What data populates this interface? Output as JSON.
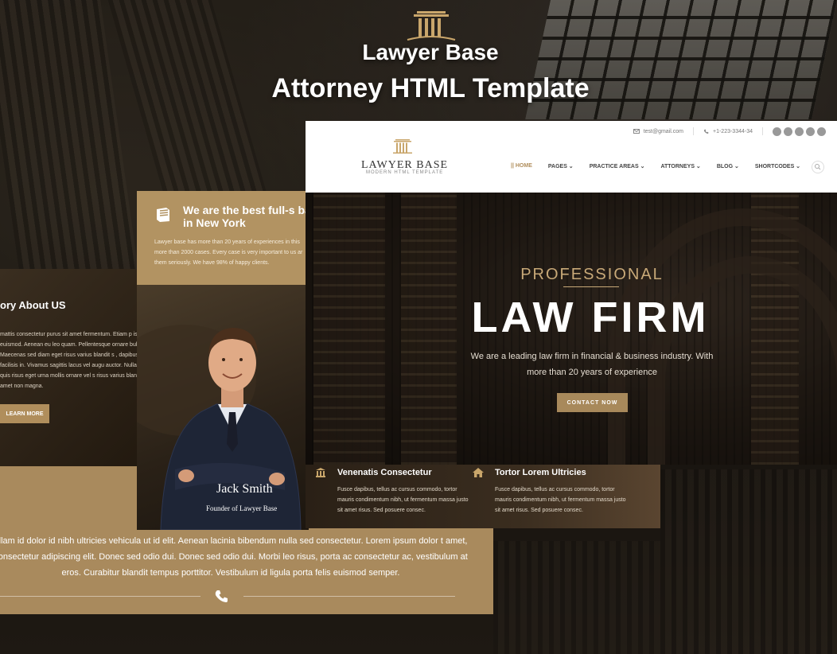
{
  "hero": {
    "line1": "Lawyer Base",
    "line2": "Attorney HTML Template"
  },
  "story": {
    "heading": "ory About US",
    "body": "mattis consectetur purus sit amet fermentum. Etiam p is euismod. Aenean eu leo quam. Pellentesque ornare bulum. Maecenas sed diam eget risus varius blandit s , dapibus ac facilisis in. Vivamus sagittis lacus vel augu auctor. Nullam quis risus eget urna mollis ornare vel s risus varius blandit sit amet non magna.",
    "button": "LEARN MORE"
  },
  "best": {
    "heading": "We are the best full-s based in New York",
    "body": "Lawyer base has more than 20 years of experiences in this more than 2000 cases. Every case is very important to us ar them seriously. We have 98% of happy clients."
  },
  "portrait": {
    "name": "Jack Smith",
    "role": "Founder of Lawyer Base"
  },
  "lower": {
    "text": "ullam id dolor id nibh ultricies vehicula ut id elit. Aenean lacinia bibendum nulla sed consectetur. Lorem ipsum dolor t amet, consectetur adipiscing elit. Donec sed odio dui. Donec sed odio dui. Morbi leo risus, porta ac consectetur ac, vestibulum at eros. Curabitur blandit tempus porttitor. Vestibulum id ligula porta felis euismod semper."
  },
  "site": {
    "topbar": {
      "email": "test@gmail.com",
      "phone": "+1-223-3344-34"
    },
    "brand": "LAWYER BASE",
    "brand_sub": "MODERN HTML TEMPLATE",
    "nav": [
      {
        "label": "HOME",
        "active": true
      },
      {
        "label": "PAGES ⌄",
        "active": false
      },
      {
        "label": "PRACTICE AREAS ⌄",
        "active": false
      },
      {
        "label": "ATTORNEYS ⌄",
        "active": false
      },
      {
        "label": "BLOG ⌄",
        "active": false
      },
      {
        "label": "SHORTCODES ⌄",
        "active": false
      }
    ],
    "hero": {
      "kicker": "PROFESSIONAL",
      "title": "LAW FIRM",
      "lead": "We are a leading law firm in financial & business industry. With more than 20 years of experience",
      "cta": "CONTACT NOW"
    }
  },
  "features": [
    {
      "icon": "courthouse-icon",
      "title": "Venenatis Consectetur",
      "body": "Fusce dapibus, tellus ac cursus commodo, tortor mauris condimentum nibh, ut fermentum massa justo sit amet risus. Sed posuere consec."
    },
    {
      "icon": "home-icon",
      "title": "Tortor Lorem Ultricies",
      "body": "Fusce dapibus, tellus ac cursus commodo, tortor mauris condimentum nibh, ut fermentum massa justo sit amet risus. Sed posuere consec."
    }
  ],
  "colors": {
    "gold": "#b08e5c",
    "tan_panel": "#a98a5d",
    "dark": "#1c1712"
  }
}
